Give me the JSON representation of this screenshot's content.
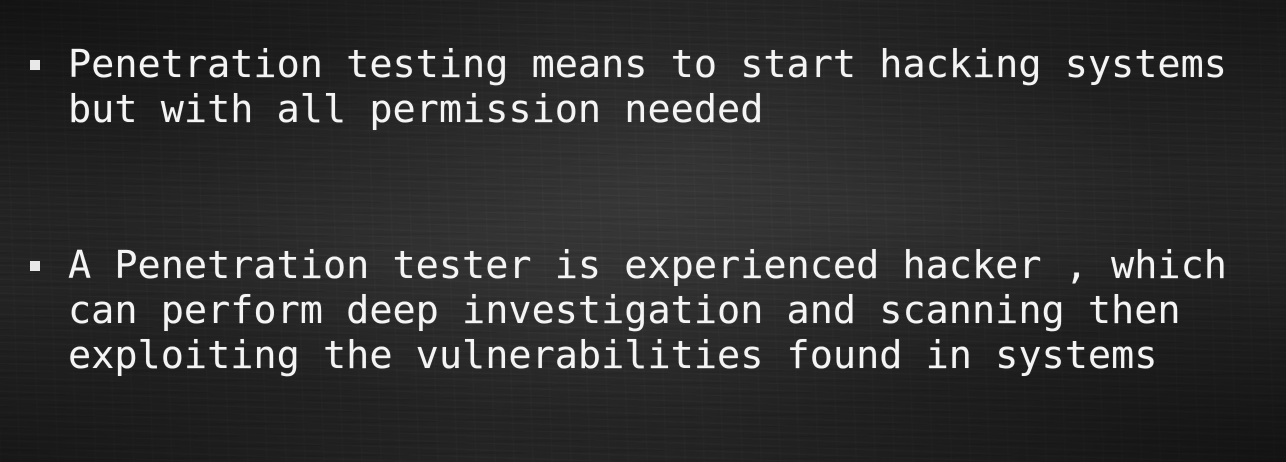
{
  "slide": {
    "bullets": [
      {
        "text": "Penetration testing means to start hacking systems\nbut with all permission needed"
      },
      {
        "text": "A Penetration tester is experienced hacker , which\ncan perform deep investigation and scanning then\nexploiting the vulnerabilities found in systems"
      }
    ]
  },
  "colors": {
    "background": "#2a2a2a",
    "text": "#f4f4f4"
  }
}
